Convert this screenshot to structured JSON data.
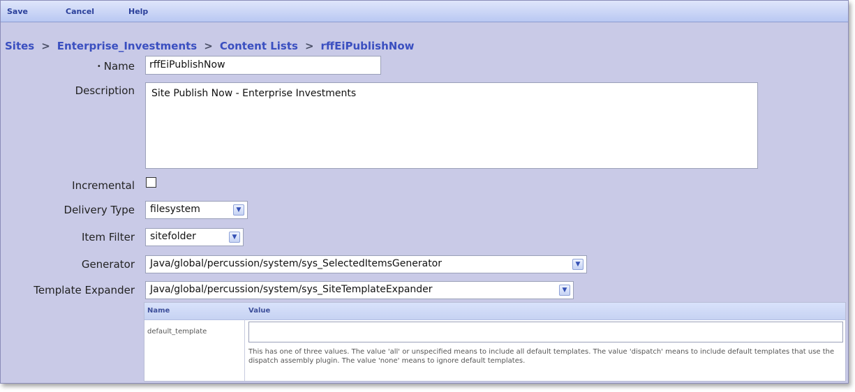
{
  "toolbar": {
    "save_label": "Save",
    "cancel_label": "Cancel",
    "help_label": "Help"
  },
  "breadcrumb": {
    "items": [
      "Sites",
      "Enterprise_Investments",
      "Content Lists",
      "rffEiPublishNow"
    ],
    "separator": ">"
  },
  "form": {
    "name": {
      "label": "Name",
      "required_marker": "•",
      "value": "rffEiPublishNow"
    },
    "description": {
      "label": "Description",
      "value": "Site Publish Now - Enterprise Investments"
    },
    "incremental": {
      "label": "Incremental",
      "checked": false
    },
    "delivery_type": {
      "label": "Delivery Type",
      "value": "filesystem"
    },
    "item_filter": {
      "label": "Item Filter",
      "value": "sitefolder"
    },
    "generator": {
      "label": "Generator",
      "value": "Java/global/percussion/system/sys_SelectedItemsGenerator"
    },
    "template_expander": {
      "label": "Template Expander",
      "value": "Java/global/percussion/system/sys_SiteTemplateExpander"
    }
  },
  "params": {
    "headers": {
      "name": "Name",
      "value": "Value"
    },
    "rows": [
      {
        "name": "default_template",
        "value": "",
        "help": "This has one of three values. The value 'all' or unspecified means to include all default templates. The value 'dispatch' means to include default templates that use the dispatch assembly plugin. The value 'none' means to ignore default templates."
      }
    ]
  },
  "colors": {
    "background": "#c9cae7",
    "toolbar": "#c6d2f5",
    "link": "#3a4fc0"
  },
  "icons": {
    "dropdown": "chevron-down-icon"
  }
}
